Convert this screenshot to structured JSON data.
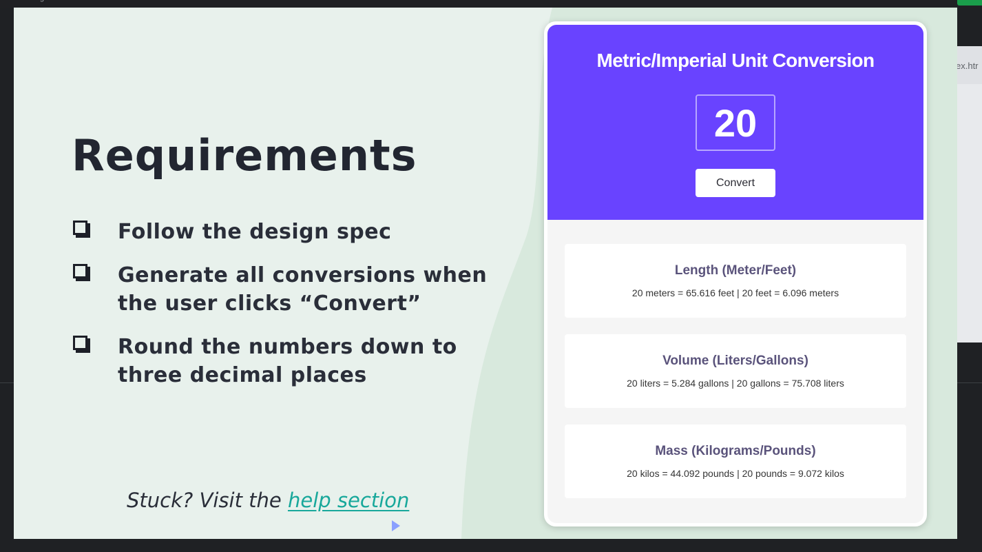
{
  "browser": {
    "window_title_fragment": "g",
    "background_tab_text": "ex.htr"
  },
  "slide": {
    "title": "Requirements",
    "requirements": [
      {
        "line1": "Follow the design spec",
        "line2": ""
      },
      {
        "line1": "Generate all conversions when",
        "line2": "the user clicks “Convert”"
      },
      {
        "line1": "Round the numbers down to",
        "line2": "three decimal places"
      }
    ],
    "stuck_prefix": "Stuck? Visit the ",
    "help_link": "help section"
  },
  "app": {
    "title": "Metric/Imperial Unit Conversion",
    "input_value": "20",
    "convert_label": "Convert",
    "accent_color": "#6943ff",
    "results": [
      {
        "title": "Length (Meter/Feet)",
        "value": "20 meters = 65.616 feet | 20 feet = 6.096 meters"
      },
      {
        "title": "Volume (Liters/Gallons)",
        "value": "20 liters = 5.284 gallons | 20 gallons = 75.708 liters"
      },
      {
        "title": "Mass (Kilograms/Pounds)",
        "value": "20 kilos = 44.092 pounds | 20 pounds = 9.072 kilos"
      }
    ]
  },
  "colors": {
    "slide_background": "#e8f1ec",
    "link": "#18a89b",
    "text_dark": "#2a2e39"
  }
}
